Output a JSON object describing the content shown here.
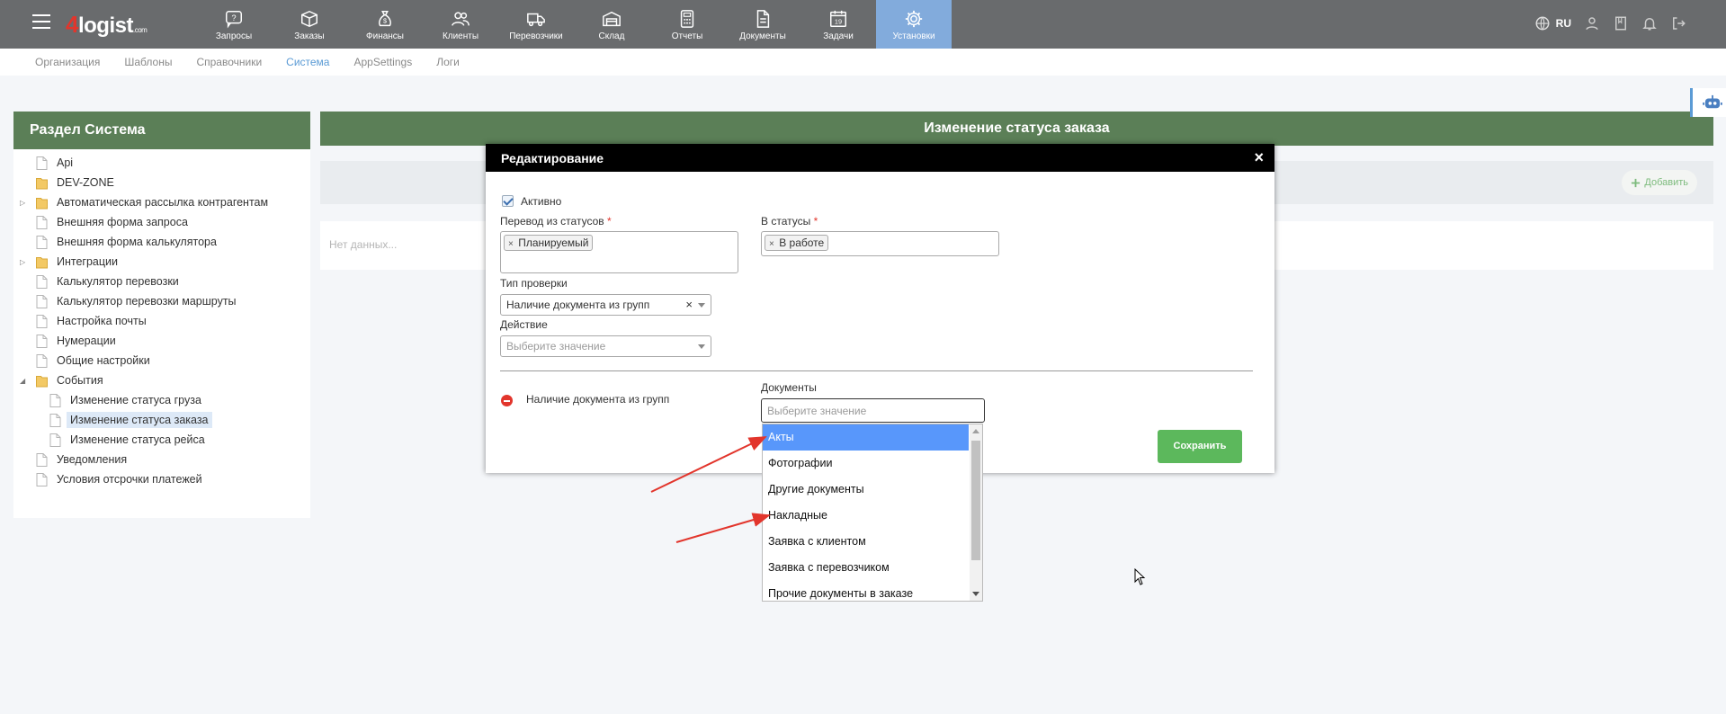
{
  "app": {
    "logo": {
      "number": "4",
      "name": "logist",
      "domain": ".com"
    },
    "nav": [
      {
        "label": "Запросы",
        "icon": "question-chat-icon"
      },
      {
        "label": "Заказы",
        "icon": "box-icon"
      },
      {
        "label": "Финансы",
        "icon": "money-bag-icon"
      },
      {
        "label": "Клиенты",
        "icon": "users-icon"
      },
      {
        "label": "Перевозчики",
        "icon": "truck-icon"
      },
      {
        "label": "Склад",
        "icon": "warehouse-icon"
      },
      {
        "label": "Отчеты",
        "icon": "calculator-icon"
      },
      {
        "label": "Документы",
        "icon": "document-icon"
      },
      {
        "label": "Задачи",
        "icon": "calendar-icon"
      },
      {
        "label": "Установки",
        "icon": "gear-icon",
        "active": true
      }
    ],
    "lang": "RU"
  },
  "subtabs": [
    {
      "label": "Организация"
    },
    {
      "label": "Шаблоны"
    },
    {
      "label": "Справочники"
    },
    {
      "label": "Система",
      "active": true
    },
    {
      "label": "AppSettings"
    },
    {
      "label": "Логи"
    }
  ],
  "sidebar": {
    "title": "Раздел Система",
    "items": [
      {
        "label": "Api",
        "type": "file",
        "level": 0
      },
      {
        "label": "DEV-ZONE",
        "type": "folder",
        "level": 0
      },
      {
        "label": "Автоматическая рассылка контрагентам",
        "type": "folder",
        "level": 0,
        "expander": "closed"
      },
      {
        "label": "Внешняя форма запроса",
        "type": "file",
        "level": 0
      },
      {
        "label": "Внешняя форма калькулятора",
        "type": "file",
        "level": 0
      },
      {
        "label": "Интеграции",
        "type": "folder",
        "level": 0,
        "expander": "closed"
      },
      {
        "label": "Калькулятор перевозки",
        "type": "file",
        "level": 0
      },
      {
        "label": "Калькулятор перевозки маршруты",
        "type": "file",
        "level": 0
      },
      {
        "label": "Настройка почты",
        "type": "file",
        "level": 0
      },
      {
        "label": "Нумерации",
        "type": "file",
        "level": 0
      },
      {
        "label": "Общие настройки",
        "type": "file",
        "level": 0
      },
      {
        "label": "События",
        "type": "folder",
        "level": 0,
        "expander": "open"
      },
      {
        "label": "Изменение статуса груза",
        "type": "file",
        "level": 1
      },
      {
        "label": "Изменение статуса заказа",
        "type": "file",
        "level": 1,
        "selected": true
      },
      {
        "label": "Изменение статуса рейса",
        "type": "file",
        "level": 1
      },
      {
        "label": "Уведомления",
        "type": "file",
        "level": 0
      },
      {
        "label": "Условия отсрочки платежей",
        "type": "file",
        "level": 0
      }
    ]
  },
  "main": {
    "title": "Изменение статуса заказа",
    "add_label": "Добавить",
    "empty_text": "Нет данных..."
  },
  "modal": {
    "title": "Редактирование",
    "close": "×",
    "active_label": "Активно",
    "from_status_label": "Перевод из статусов",
    "from_status_tags": [
      "Планируемый"
    ],
    "to_status_label": "В статусы",
    "to_status_tags": [
      "В работе"
    ],
    "required_mark": "*",
    "check_type_label": "Тип проверки",
    "check_type_value": "Наличие документа из групп",
    "action_label": "Действие",
    "action_placeholder": "Выберите значение",
    "rule_label": "Наличие документа из групп",
    "documents_label": "Документы",
    "documents_placeholder": "Выберите значение",
    "save_label": "Сохранить"
  },
  "dropdown": {
    "options": [
      {
        "label": "Акты",
        "highlighted": true
      },
      {
        "label": "Фотографии"
      },
      {
        "label": "Другие документы"
      },
      {
        "label": "Накладные"
      },
      {
        "label": "Заявка с клиентом"
      },
      {
        "label": "Заявка с перевозчиком"
      },
      {
        "label": "Прочие документы в заказе"
      }
    ]
  },
  "colors": {
    "topbar": "#696b6d",
    "nav_active": "#82abdc",
    "panel_header": "#5b7f57",
    "accent_red": "#e2352c",
    "save_green": "#5cb85c",
    "option_highlight": "#5897fb"
  }
}
